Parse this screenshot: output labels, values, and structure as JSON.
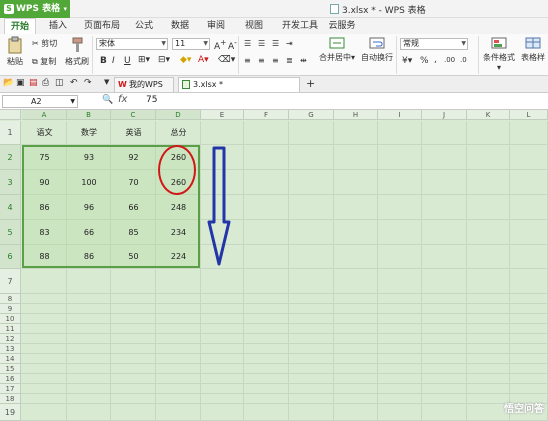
{
  "app": {
    "name": "WPS 表格",
    "window_title": "3.xlsx * - WPS 表格"
  },
  "menu_tabs": [
    "开始",
    "插入",
    "页面布局",
    "公式",
    "数据",
    "审阅",
    "视图",
    "开发工具",
    "云服务"
  ],
  "ribbon": {
    "paste": "粘贴",
    "cut": "剪切",
    "copy": "复制",
    "format_painter": "格式刷",
    "font_name": "宋体",
    "font_size": "11",
    "bold": "B",
    "italic": "I",
    "underline": "U",
    "merge_center": "合并居中",
    "wrap_text": "自动换行",
    "number_format": "常规",
    "percent": "%",
    "comma": ",",
    "conditional_format": "条件格式",
    "table_style": "表格样"
  },
  "doc_tabs": [
    "我的WPS",
    "3.xlsx *"
  ],
  "name_box": "A2",
  "formula_value": "75",
  "columns": [
    "A",
    "B",
    "C",
    "D",
    "E",
    "F",
    "G",
    "H",
    "I",
    "J",
    "K",
    "L"
  ],
  "rows": [
    "1",
    "2",
    "3",
    "4",
    "5",
    "6",
    "7",
    "8",
    "9",
    "10",
    "11",
    "12",
    "13",
    "14",
    "15",
    "16",
    "17",
    "18",
    "19"
  ],
  "table": {
    "headers": [
      "语文",
      "数学",
      "英语",
      "总分"
    ],
    "data": [
      [
        "75",
        "93",
        "92",
        "260"
      ],
      [
        "90",
        "100",
        "70",
        "260"
      ],
      [
        "86",
        "96",
        "66",
        "248"
      ],
      [
        "83",
        "66",
        "85",
        "234"
      ],
      [
        "88",
        "86",
        "50",
        "224"
      ]
    ]
  },
  "watermark": "悟空问答",
  "colors": {
    "accent_green": "#52a739",
    "circle_red": "#d01818",
    "arrow_blue": "#2236a8"
  }
}
